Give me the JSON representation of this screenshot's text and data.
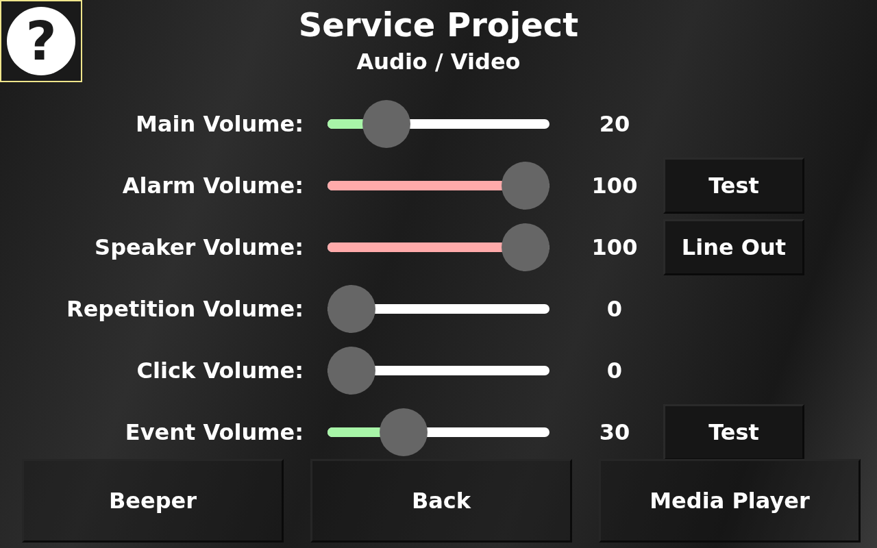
{
  "help_button": {
    "label": "?"
  },
  "title": "Service Project",
  "subtitle": "Audio / Video",
  "rows": [
    {
      "label": "Main Volume:",
      "level": 0.2,
      "color": "#a8f5a8",
      "reading": "20"
    },
    {
      "label": "Alarm Volume:",
      "level": 1,
      "color": "#ffaaaa",
      "reading": "100",
      "button": "Test"
    },
    {
      "label": "Speaker Volume:",
      "level": 1,
      "color": "#ffaaaa",
      "reading": "100",
      "button": "Line Out"
    },
    {
      "label": "Repetition Volume:",
      "level": 0,
      "reading": "0"
    },
    {
      "label": "Click Volume:",
      "level": 0,
      "reading": "0"
    },
    {
      "label": "Event Volume:",
      "level": 0.3,
      "color": "#a8f5a8",
      "reading": "30",
      "button": "Test"
    }
  ],
  "bottom_buttons": [
    "Beeper",
    "Back",
    "Media Player"
  ]
}
